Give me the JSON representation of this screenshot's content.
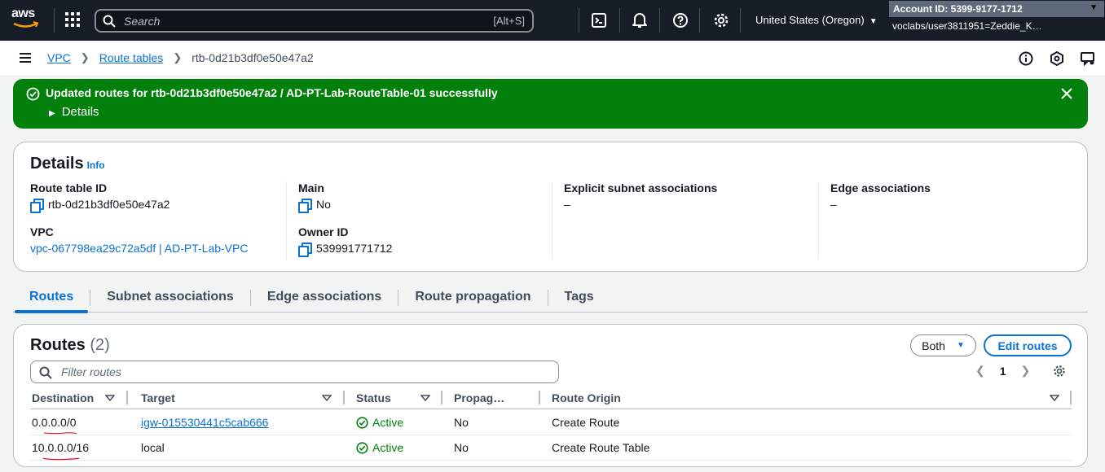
{
  "topnav": {
    "logo_text": "aws",
    "search_placeholder": "Search",
    "search_shortcut": "[Alt+S]",
    "region": "United States (Oregon)",
    "account": "Account ID: 5399-9177-1712",
    "user": "voclabs/user3811951=Zeddie_K…"
  },
  "breadcrumb": {
    "items": [
      "VPC",
      "Route tables"
    ],
    "current": "rtb-0d21b3df0e50e47a2"
  },
  "flash": {
    "message": "Updated routes for rtb-0d21b3df0e50e47a2 / AD-PT-Lab-RouteTable-01 successfully",
    "details": "Details",
    "color": "#037f0c"
  },
  "details": {
    "title": "Details",
    "info": "Info",
    "route_table_id_label": "Route table ID",
    "route_table_id": "rtb-0d21b3df0e50e47a2",
    "vpc_label": "VPC",
    "vpc": "vpc-067798ea29c72a5df | AD-PT-Lab-VPC",
    "main_label": "Main",
    "main": "No",
    "owner_label": "Owner ID",
    "owner": "539991771712",
    "explicit_label": "Explicit subnet associations",
    "explicit": "–",
    "edge_label": "Edge associations",
    "edge": "–"
  },
  "tabs": [
    "Routes",
    "Subnet associations",
    "Edge associations",
    "Route propagation",
    "Tags"
  ],
  "routes": {
    "title": "Routes",
    "count": "(2)",
    "both_label": "Both",
    "edit_label": "Edit routes",
    "filter_placeholder": "Filter routes",
    "page": "1",
    "columns": [
      "Destination",
      "Target",
      "Status",
      "Propag…",
      "Route Origin"
    ],
    "rows": [
      {
        "destination": "0.0.0.0/0",
        "target": "igw-015530441c5cab666",
        "status": "Active",
        "propagated": "No",
        "origin": "Create Route"
      },
      {
        "destination": "10.0.0.0/16",
        "target": "local",
        "status": "Active",
        "propagated": "No",
        "origin": "Create Route Table"
      }
    ]
  },
  "colors": {
    "accent": "#0972d3",
    "success": "#037f0c",
    "nav_bg": "#161d26",
    "annotation": "#e0001b"
  }
}
